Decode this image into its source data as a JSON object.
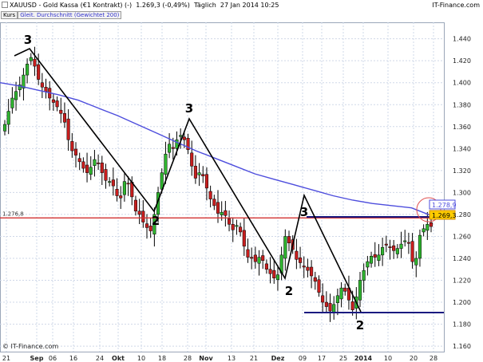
{
  "header": {
    "instrument": "XAUUSD - Gold Kassa (€1 Kontrakt) (-)",
    "price": "1.269,3 (-0,49%)",
    "period": "Täglich",
    "datetime": "27 Jan 2014 10:25",
    "brand": "IT-Finance.com"
  },
  "legend": {
    "series_label": "Kurs",
    "ma_label": "Gleit. Durchschnitt (Gewichtet 200)"
  },
  "watermark": "© IT-Finance.com",
  "colors": {
    "up_candle": "#2fb52f",
    "down_candle": "#c81e1e",
    "moving_average": "#4d4ddd",
    "resistance_line": "#d23232",
    "support_lines": "#1a1a80",
    "wave_lines": "#000000",
    "grid": "#cfd8e8"
  },
  "chart_data": {
    "type": "candlestick",
    "title": "",
    "xlabel": "",
    "ylabel": "",
    "ylim": [
      1.155,
      1.455
    ],
    "grid": true,
    "y_ticks": [
      "1.160",
      "1.180",
      "1.200",
      "1.220",
      "1.240",
      "1.260",
      "1.280",
      "1.300",
      "1.320",
      "1.340",
      "1.360",
      "1.380",
      "1.400",
      "1.420",
      "1.440"
    ],
    "x_ticks": [
      "21",
      "Sep",
      "06",
      "16",
      "24",
      "Okt",
      "10",
      "18",
      "28",
      "Nov",
      "13",
      "21",
      "Dez",
      "09",
      "17",
      "25",
      "2014",
      "10",
      "20",
      "28"
    ],
    "series": [
      {
        "name": "Kurs",
        "closes": [
          1.362,
          1.374,
          1.386,
          1.392,
          1.398,
          1.407,
          1.417,
          1.423,
          1.415,
          1.403,
          1.396,
          1.392,
          1.386,
          1.382,
          1.378,
          1.372,
          1.364,
          1.348,
          1.338,
          1.334,
          1.328,
          1.322,
          1.318,
          1.323,
          1.33,
          1.327,
          1.318,
          1.311,
          1.31,
          1.306,
          1.297,
          1.295,
          1.31,
          1.308,
          1.296,
          1.283,
          1.28,
          1.273,
          1.268,
          1.265,
          1.28,
          1.3,
          1.318,
          1.335,
          1.344,
          1.34,
          1.348,
          1.352,
          1.348,
          1.339,
          1.324,
          1.313,
          1.318,
          1.315,
          1.304,
          1.294,
          1.288,
          1.281,
          1.282,
          1.279,
          1.271,
          1.266,
          1.27,
          1.264,
          1.251,
          1.241,
          1.24,
          1.237,
          1.241,
          1.238,
          1.23,
          1.226,
          1.222,
          1.225,
          1.243,
          1.26,
          1.254,
          1.248,
          1.239,
          1.236,
          1.232,
          1.229,
          1.224,
          1.219,
          1.209,
          1.2,
          1.196,
          1.192,
          1.198,
          1.206,
          1.213,
          1.21,
          1.202,
          1.193,
          1.205,
          1.22,
          1.229,
          1.237,
          1.242,
          1.241,
          1.243,
          1.25,
          1.252,
          1.25,
          1.247,
          1.249,
          1.253,
          1.256,
          1.254,
          1.237,
          1.24,
          1.261,
          1.267,
          1.271,
          1.269
        ]
      },
      {
        "name": "Gleit. Durchschnitt (Gewichtet 200)",
        "values": [
          1.4,
          1.397,
          1.393,
          1.389,
          1.384,
          1.377,
          1.37,
          1.362,
          1.354,
          1.346,
          1.338,
          1.331,
          1.324,
          1.317,
          1.312,
          1.307,
          1.302,
          1.297,
          1.293,
          1.29,
          1.288,
          1.286,
          1.279
        ]
      }
    ],
    "levels": [
      {
        "label": "1.276,8",
        "value": 1.2768
      },
      {
        "label": "1.278,9",
        "value": 1.2789
      },
      {
        "label": "1.269,3",
        "value": 1.2693
      }
    ],
    "wave_labels": [
      "3",
      "2",
      "3",
      "2",
      "3",
      "2"
    ]
  }
}
